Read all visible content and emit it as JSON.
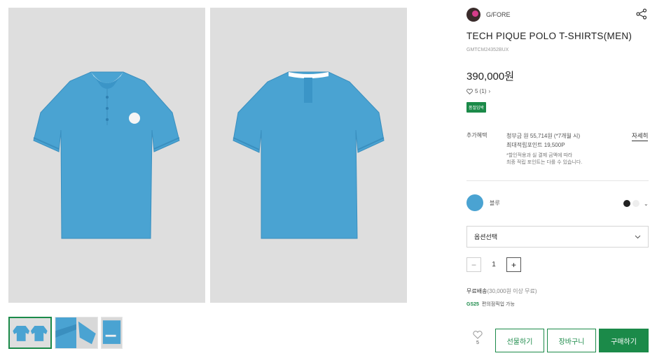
{
  "product": {
    "brand": "G/FORE",
    "title": "TECH PIQUE POLO T-SHIRTS(MEN)",
    "code": "GMTCM24352BUX",
    "price": "390,000원",
    "review_count": "5 (1)",
    "badge": "품절임박"
  },
  "benefits": {
    "label": "추가혜택",
    "installment": "청부금 원 55,714원 (*7개월 시)",
    "points_label": "최대적립포인트 19,500P",
    "note_line1": "*할인적용과 실 결제 금액에 따라",
    "note_line2": "최종 적립 포인트는 다를 수 있습니다.",
    "detail_link": "자세히"
  },
  "color": {
    "selected_name": "블루",
    "selected_hex": "#4aa3d2",
    "swatches": [
      "#222222",
      "#eeeeee"
    ]
  },
  "option_select": {
    "value": "옵션선택"
  },
  "quantity": {
    "minus": "−",
    "value": "1",
    "plus": "+"
  },
  "shipping": {
    "free": "무료배송",
    "condition": "(30,000원 이상 무료)",
    "gs_label": "GS25",
    "gs_text": "편의점픽업 가능"
  },
  "actions": {
    "like_count": "5",
    "gift": "선물하기",
    "cart": "장바구니",
    "buy": "구매하기"
  },
  "colors": {
    "accent": "#1b8a49",
    "shirt": "#4aa3d2"
  }
}
